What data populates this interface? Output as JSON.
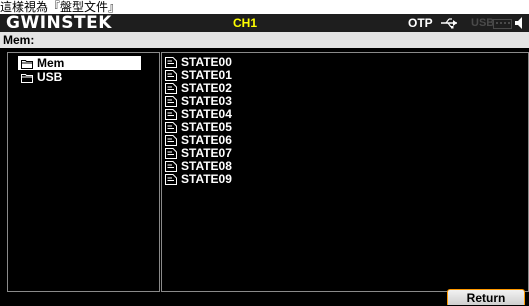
{
  "caption": "這樣視為『盤型文件』",
  "header": {
    "brand": "GWINSTEK",
    "channel": "CH1",
    "otp": "OTP",
    "usb_label": "USB",
    "icons": [
      "usb-connection-icon",
      "keyboard-lock-icon",
      "speaker-icon"
    ]
  },
  "path": {
    "label": "Mem:"
  },
  "tree": {
    "items": [
      {
        "label": "Mem",
        "selected": true
      },
      {
        "label": "USB",
        "selected": false
      }
    ]
  },
  "files": [
    {
      "name": "STATE00"
    },
    {
      "name": "STATE01"
    },
    {
      "name": "STATE02"
    },
    {
      "name": "STATE03"
    },
    {
      "name": "STATE04"
    },
    {
      "name": "STATE05"
    },
    {
      "name": "STATE06"
    },
    {
      "name": "STATE07"
    },
    {
      "name": "STATE08"
    },
    {
      "name": "STATE09"
    }
  ],
  "footer": {
    "return_label": "Return"
  },
  "colors": {
    "channel": "#ffff00",
    "softkey_border": "#ff9900",
    "disabled": "#4a4a4a"
  }
}
